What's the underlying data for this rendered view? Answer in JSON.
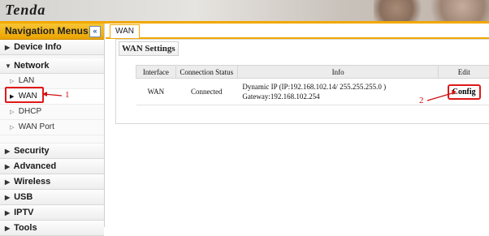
{
  "header": {
    "logo_text": "Tenda"
  },
  "sidebar": {
    "title": "Navigation Menus",
    "collapse_icon": "«",
    "items": [
      {
        "label": "Device Info",
        "icon": "right-triangle-icon",
        "expanded": false
      },
      {
        "label": "Network",
        "icon": "down-triangle-icon",
        "expanded": true,
        "children": [
          {
            "label": "LAN"
          },
          {
            "label": "WAN",
            "active": true
          },
          {
            "label": "DHCP"
          },
          {
            "label": "WAN Port"
          }
        ]
      },
      {
        "label": "Security",
        "icon": "right-triangle-icon"
      },
      {
        "label": "Advanced",
        "icon": "right-triangle-icon"
      },
      {
        "label": "Wireless",
        "icon": "right-triangle-icon"
      },
      {
        "label": "USB",
        "icon": "right-triangle-icon"
      },
      {
        "label": "IPTV",
        "icon": "right-triangle-icon"
      },
      {
        "label": "Tools",
        "icon": "right-triangle-icon"
      }
    ]
  },
  "main": {
    "tab_label": "WAN",
    "panel_title": "WAN Settings",
    "table": {
      "headers": [
        "Interface",
        "Connection Status",
        "Info",
        "Edit"
      ],
      "rows": [
        {
          "interface": "WAN",
          "status": "Connected",
          "info_line1": "Dynamic IP (IP:192.168.102.14/ 255.255.255.0 )",
          "info_line2": "Gateway:192.168.102.254",
          "edit_label": "Config"
        }
      ]
    }
  },
  "annotations": {
    "label_1": "1",
    "label_2": "2"
  },
  "colors": {
    "accent": "#f2a800",
    "highlight": "#e01818"
  }
}
